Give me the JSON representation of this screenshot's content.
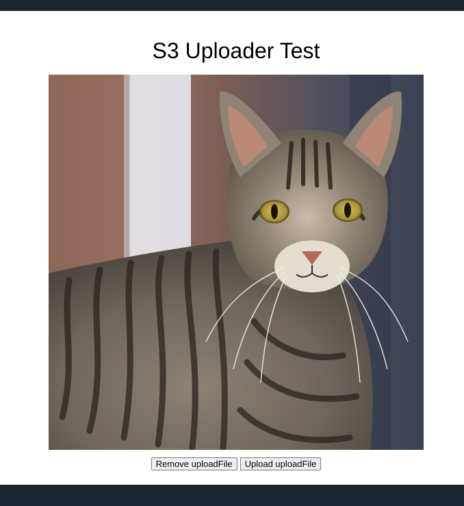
{
  "page": {
    "title": "S3 Uploader Test"
  },
  "preview": {
    "subject": "tabby cat photo"
  },
  "actions": {
    "remove_label": "Remove uploadFile",
    "upload_label": "Upload uploadFile"
  },
  "colors": {
    "header_bar": "#1b232e",
    "footer_bar": "#1b232e",
    "background": "#ffffff"
  }
}
